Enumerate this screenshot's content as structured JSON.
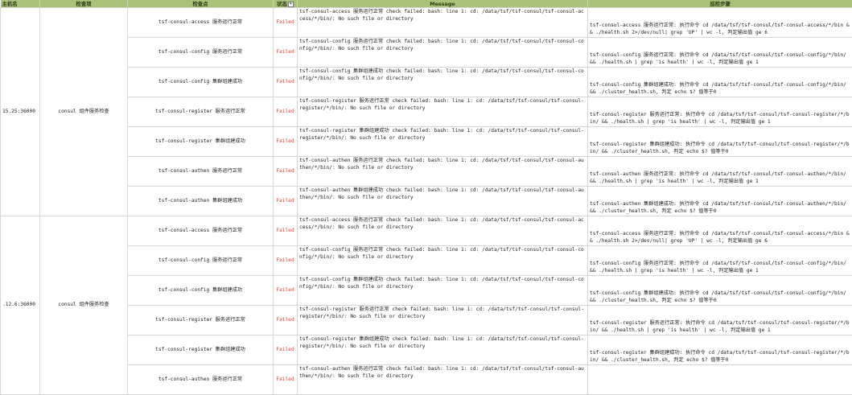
{
  "headers": {
    "host": "主机名",
    "item": "检查项",
    "point": "检查点",
    "status": "状态",
    "message": "Message",
    "steps": "巡检步骤"
  },
  "filter_icon": "filter-dropdown-icon",
  "groups": [
    {
      "host": "15.25:36000",
      "item": "consul 组件服务检查",
      "rows": [
        {
          "point": "tsf-consul-access 服务运行正常",
          "status": "Failed",
          "message": "tsf-consul-access 服务运行正常 check failed: bash: line 1: cd: /data/tsf/tsf-consul/tsf-consul-access/*/bin/: No such file or directory",
          "steps": "tsf-consul-access 服务运行正常: 执行命令 cd /data/tsf/tsf-consul/tsf-consul-access/*/bin && ./health.sh 2>/dev/null| grep 'UP' | wc -l, 判定输出值 ge 6"
        },
        {
          "point": "tsf-consul-config 服务运行正常",
          "status": "Failed",
          "message": "tsf-consul-config 服务运行正常 check failed: bash: line 1: cd: /data/tsf/tsf-consul/tsf-consul-config/*/bin/: No such file or directory",
          "steps": "tsf-consul-config 服务运行正常: 执行命令 cd /data/tsf/tsf-consul/tsf-consul-config/*/bin/ && ./health.sh | grep 'is health' | wc -l, 判定输出值 ge 1"
        },
        {
          "point": "tsf-consul-config 集群组建成功",
          "status": "Failed",
          "message": "tsf-consul-config 集群组建成功 check failed: bash: line 1: cd: /data/tsf/tsf-consul/tsf-consul-config/*/bin/: No such file or directory",
          "steps": "tsf-consul-config 集群组建成功: 执行命令 cd /data/tsf/tsf-consul/tsf-consul-config/*/bin/ && ./cluster_health.sh, 判定 echo $? 值等于0"
        },
        {
          "point": "tsf-consul-register 服务运行正常",
          "status": "Failed",
          "message": "tsf-consul-register 服务运行正常 check failed: bash: line 1: cd: /data/tsf/tsf-consul/tsf-consul-register/*/bin/: No such file or directory",
          "steps": "tsf-consul-register 服务运行正常: 执行命令 cd /data/tsf/tsf-consul/tsf-consul-register/*/bin/ && ./health.sh | grep 'is health' | wc -l, 判定输出值 ge 1"
        },
        {
          "point": "tsf-consul-register 集群组建成功",
          "status": "Failed",
          "message": "tsf-consul-register 集群组建成功 check failed: bash: line 1: cd: /data/tsf/tsf-consul/tsf-consul-register/*/bin/: No such file or directory",
          "steps": "tsf-consul-register 集群组建成功: 执行命令 cd /data/tsf/tsf-consul/tsf-consul-register/*/bin/ && ./cluster_health.sh, 判定 echo $? 值等于0"
        },
        {
          "point": "tsf-consul-authen 服务运行正常",
          "status": "Failed",
          "message": "tsf-consul-authen 服务运行正常 check failed: bash: line 1: cd: /data/tsf/tsf-consul/tsf-consul-authen/*/bin/: No such file or directory",
          "steps": "tsf-consul-authen 服务运行正常: 执行命令 cd /data/tsf/tsf-consul/tsf-consul-authen/*/bin/ && ./health.sh | grep 'is health' | wc -l, 判定输出值 ge 1"
        },
        {
          "point": "tsf-consul-authen 集群组建成功",
          "status": "Failed",
          "message": "tsf-consul-authen 集群组建成功 check failed: bash: line 1: cd: /data/tsf/tsf-consul/tsf-consul-authen/*/bin/: No such file or directory",
          "steps": "tsf-consul-authen 集群组建成功: 执行命令 cd /data/tsf/tsf-consul/tsf-consul-authen/*/bin/ && ./cluster_health.sh, 判定 echo $? 值等于0"
        }
      ]
    },
    {
      "host": ".12.6:36000",
      "item": "consul 组件服务检查",
      "rows": [
        {
          "point": "tsf-consul-access 服务运行正常",
          "status": "Failed",
          "message": "tsf-consul-access 服务运行正常 check failed: bash: line 1: cd: /data/tsf/tsf-consul/tsf-consul-access/*/bin/: No such file or directory",
          "steps": "tsf-consul-access 服务运行正常: 执行命令 cd /data/tsf/tsf-consul/tsf-consul-access/*/bin && ./health.sh 2>/dev/null| grep 'UP' | wc -l, 判定输出值 ge 6"
        },
        {
          "point": "tsf-consul-config 服务运行正常",
          "status": "Failed",
          "message": "tsf-consul-config 服务运行正常 check failed: bash: line 1: cd: /data/tsf/tsf-consul/tsf-consul-config/*/bin/: No such file or directory",
          "steps": "tsf-consul-config 服务运行正常: 执行命令 cd /data/tsf/tsf-consul/tsf-consul-config/*/bin/ && ./health.sh | grep 'is health' | wc -l, 判定输出值 ge 1"
        },
        {
          "point": "tsf-consul-config 集群组建成功",
          "status": "Failed",
          "message": "tsf-consul-config 集群组建成功 check failed: bash: line 1: cd: /data/tsf/tsf-consul/tsf-consul-config/*/bin/: No such file or directory",
          "steps": "tsf-consul-config 集群组建成功: 执行命令 cd /data/tsf/tsf-consul/tsf-consul-config/*/bin/ && ./cluster_health.sh, 判定 echo $? 值等于0"
        },
        {
          "point": "tsf-consul-register 服务运行正常",
          "status": "Failed",
          "message": "tsf-consul-register 服务运行正常 check failed: bash: line 1: cd: /data/tsf/tsf-consul/tsf-consul-register/*/bin/: No such file or directory",
          "steps": "tsf-consul-register 服务运行正常: 执行命令 cd /data/tsf/tsf-consul/tsf-consul-register/*/bin/ && ./health.sh | grep 'is health' | wc -l, 判定输出值 ge 1"
        },
        {
          "point": "tsf-consul-register 集群组建成功",
          "status": "Failed",
          "message": "tsf-consul-register 集群组建成功 check failed: bash: line 1: cd: /data/tsf/tsf-consul/tsf-consul-register/*/bin/: No such file or directory",
          "steps": "tsf-consul-register 集群组建成功: 执行命令 cd /data/tsf/tsf-consul/tsf-consul-register/*/bin/ && ./cluster_health.sh, 判定 echo $? 值等于0"
        },
        {
          "point": "tsf-consul-authen 服务运行正常",
          "status": "Failed",
          "message": "tsf-consul-authen 服务运行正常 check failed: bash: line 1: cd: /data/tsf/tsf-consul/tsf-consul-authen/*/bin/: No such file or directory",
          "steps": ""
        }
      ]
    }
  ]
}
